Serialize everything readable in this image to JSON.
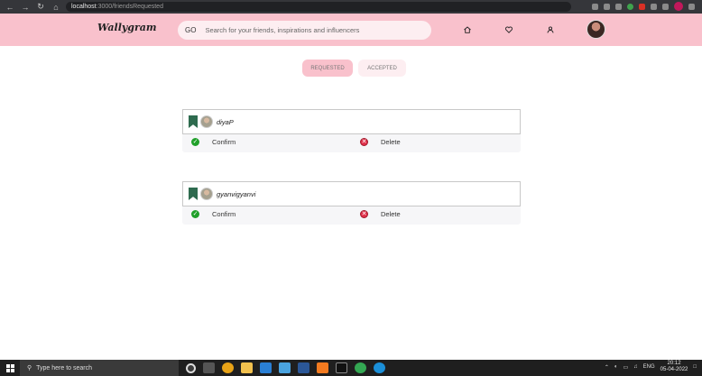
{
  "browser": {
    "url_host": "localhost",
    "url_rest": ":3000/friendsRequested",
    "nav_icons": [
      "back-icon",
      "forward-icon",
      "reload-icon",
      "home-icon"
    ]
  },
  "header": {
    "logo": "Wallygram",
    "search_go": "GO",
    "search_placeholder": "Search for your friends, inspirations and influencers",
    "icons": [
      "home-icon",
      "heart-icon",
      "profile-icon"
    ]
  },
  "tabs": [
    {
      "label": "REQUESTED",
      "active": true
    },
    {
      "label": "ACCEPTED",
      "active": false
    }
  ],
  "requests": [
    {
      "username": "diyaP",
      "confirm_label": "Confirm",
      "delete_label": "Delete"
    },
    {
      "username": "gyanvigyanvi",
      "confirm_label": "Confirm",
      "delete_label": "Delete"
    }
  ],
  "taskbar": {
    "search_placeholder": "Type here to search",
    "lang": "ENG",
    "time": "20:12",
    "date": "05-04-2022"
  },
  "colors": {
    "accent_pink": "#f9c1cc",
    "light_pink": "#fdeef1",
    "confirm_green": "#20a02a",
    "delete_red": "#e0304a"
  }
}
